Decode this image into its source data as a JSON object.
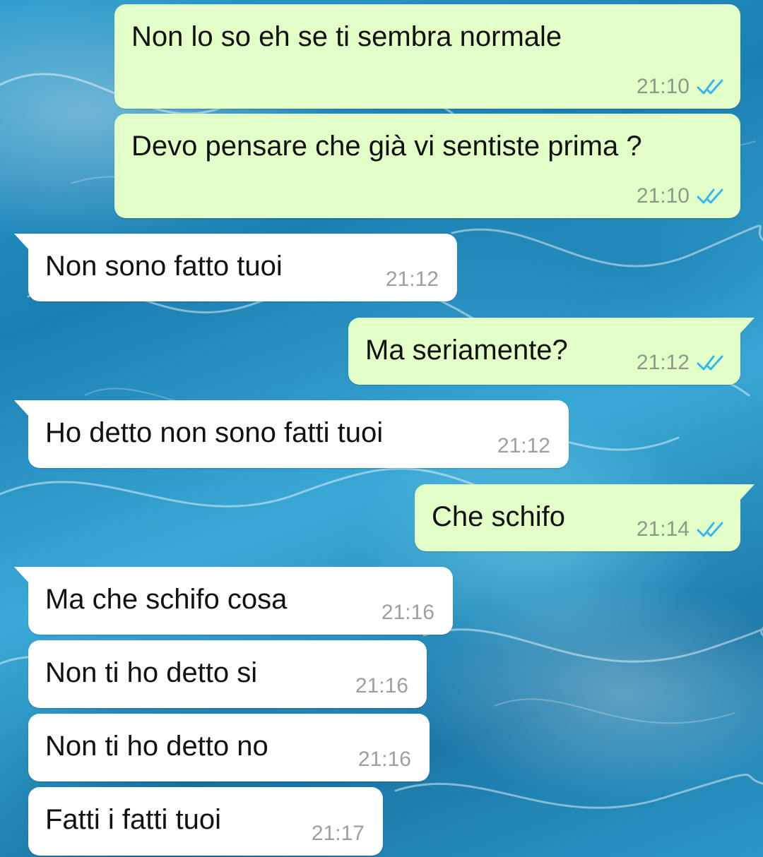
{
  "chat": {
    "messages": [
      {
        "direction": "outgoing",
        "text": "Non lo so eh se ti sembra normale",
        "time": "21:10",
        "status_icon": "double-check-read-icon"
      },
      {
        "direction": "outgoing",
        "text": "Devo pensare che già vi sentiste prima ?",
        "time": "21:10",
        "status_icon": "double-check-read-icon"
      },
      {
        "direction": "incoming",
        "text": "Non sono fatto tuoi",
        "time": "21:12"
      },
      {
        "direction": "outgoing",
        "text": "Ma seriamente?",
        "time": "21:12",
        "status_icon": "double-check-read-icon"
      },
      {
        "direction": "incoming",
        "text": "Ho detto non sono fatti tuoi",
        "time": "21:12"
      },
      {
        "direction": "outgoing",
        "text": "Che schifo",
        "time": "21:14",
        "status_icon": "double-check-read-icon"
      },
      {
        "direction": "incoming",
        "text": "Ma che schifo cosa",
        "time": "21:16"
      },
      {
        "direction": "incoming",
        "text": "Non ti ho detto si",
        "time": "21:16"
      },
      {
        "direction": "incoming",
        "text": "Non ti ho detto no",
        "time": "21:16"
      },
      {
        "direction": "incoming",
        "text": "Fatti i fatti tuoi",
        "time": "21:17"
      }
    ]
  },
  "colors": {
    "outgoing_bubble": "#e2ffc7",
    "incoming_bubble": "#ffffff",
    "read_ticks": "#34b7f1",
    "timestamp": "#8a9a8a"
  }
}
